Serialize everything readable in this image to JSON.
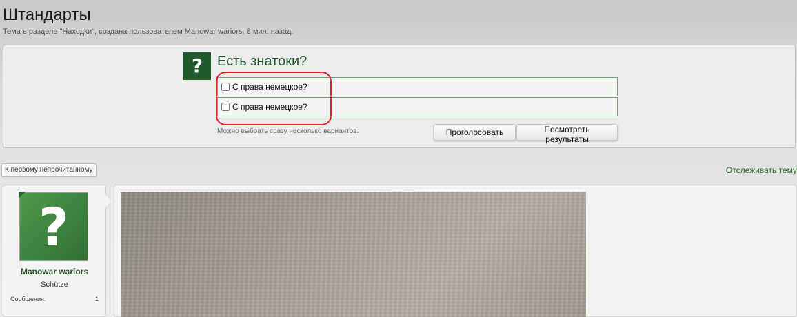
{
  "thread": {
    "title": "Штандарты",
    "description": "Тема в разделе \"Находки\", создана пользователем Manowar wariors, 8 мин. назад."
  },
  "poll": {
    "icon": "question-mark-icon",
    "icon_glyph": "?",
    "question": "Есть знатоки?",
    "options": [
      {
        "label": "С права немецкое?",
        "checked": false
      },
      {
        "label": "С права немецкое?",
        "checked": false
      }
    ],
    "hint": "Можно выбрать сразу несколько вариантов.",
    "vote_label": "Проголосовать",
    "results_label": "Посмотреть результаты",
    "highlight_color": "#e0202a"
  },
  "nav": {
    "first_unread_label": "К первому непрочитанному",
    "watch_label": "Отслеживать тему"
  },
  "post": {
    "user": {
      "avatar_glyph": "?",
      "name": "Manowar wariors",
      "title": "Schütze",
      "messages_label": "Сообщения:",
      "messages_count": "1"
    }
  },
  "colors": {
    "accent_green": "#1f5a2c",
    "link_green": "#2d6b2d"
  }
}
